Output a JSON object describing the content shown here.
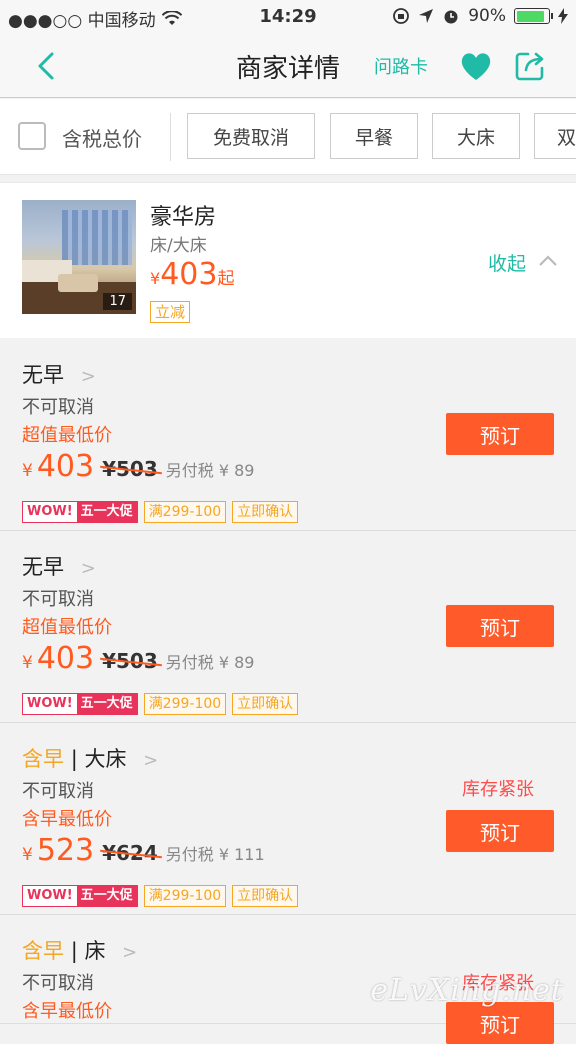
{
  "status": {
    "carrier": "●●●○○ 中国移动",
    "time": "14:29",
    "battery": "90%",
    "battery_level": 0.9
  },
  "nav": {
    "title": "商家详情",
    "route_card": "问路卡"
  },
  "filters": {
    "tax_label": "含税总价",
    "chips": [
      "免费取消",
      "早餐",
      "大床",
      "双"
    ]
  },
  "room": {
    "name": "豪华房",
    "bed": "床/大床",
    "currency": "¥",
    "price": "403",
    "price_suffix": "起",
    "promo_tag": "立减",
    "photo_count": "17",
    "collapse_label": "收起"
  },
  "rates": [
    {
      "meal": "无早",
      "bed": "",
      "cancel": "不可取消",
      "low_label": "超值最低价",
      "currency": "¥",
      "price": "403",
      "orig": "¥503",
      "tax": "另付税 ¥ 89",
      "wow": "WOW!",
      "wow2": "五一大促",
      "tag_discount": "满299-100",
      "tag_confirm": "立即确认",
      "stock": "",
      "book_label": "预订"
    },
    {
      "meal": "无早",
      "bed": "",
      "cancel": "不可取消",
      "low_label": "超值最低价",
      "currency": "¥",
      "price": "403",
      "orig": "¥503",
      "tax": "另付税 ¥ 89",
      "wow": "WOW!",
      "wow2": "五一大促",
      "tag_discount": "满299-100",
      "tag_confirm": "立即确认",
      "stock": "",
      "book_label": "预订"
    },
    {
      "meal": "含早",
      "bed": "| 大床",
      "cancel": "不可取消",
      "low_label": "含早最低价",
      "currency": "¥",
      "price": "523",
      "orig": "¥624",
      "tax": "另付税 ¥ 111",
      "wow": "WOW!",
      "wow2": "五一大促",
      "tag_discount": "满299-100",
      "tag_confirm": "立即确认",
      "stock": "库存紧张",
      "book_label": "预订"
    },
    {
      "meal": "含早",
      "bed": "| 床",
      "cancel": "不可取消",
      "low_label": "含早最低价",
      "currency": "",
      "price": "",
      "orig": "",
      "tax": "",
      "wow": "",
      "wow2": "",
      "tag_discount": "",
      "tag_confirm": "",
      "stock": "库存紧张",
      "book_label": "预订"
    }
  ],
  "watermark": "eLvXing.net",
  "colors": {
    "accent": "#1fbba6",
    "price": "#ff5a1f",
    "book": "#ff5a2a",
    "promo": "#e8345a",
    "tag": "#f5a623"
  }
}
